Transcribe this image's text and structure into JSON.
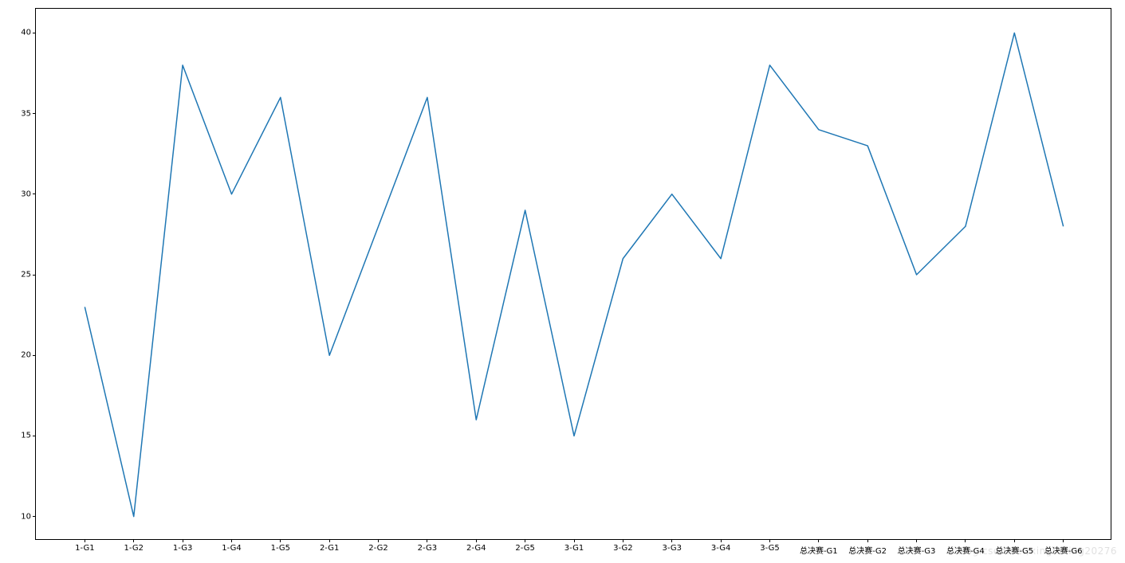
{
  "chart_data": {
    "type": "line",
    "categories": [
      "1-G1",
      "1-G2",
      "1-G3",
      "1-G4",
      "1-G5",
      "2-G1",
      "2-G2",
      "2-G3",
      "2-G4",
      "2-G5",
      "3-G1",
      "3-G2",
      "3-G3",
      "3-G4",
      "3-G5",
      "总决赛-G1",
      "总决赛-G2",
      "总决赛-G3",
      "总决赛-G4",
      "总决赛-G5",
      "总决赛-G6"
    ],
    "values": [
      23,
      10,
      38,
      30,
      36,
      20,
      28,
      36,
      16,
      29,
      15,
      26,
      30,
      26,
      38,
      34,
      33,
      25,
      28,
      40,
      28
    ],
    "title": "",
    "xlabel": "",
    "ylabel": "",
    "ylim": [
      8.5,
      41.5
    ],
    "xlim": [
      -1,
      21
    ],
    "yticks": [
      10,
      15,
      20,
      25,
      30,
      35,
      40
    ],
    "line_color": "#1f77b4"
  },
  "layout": {
    "axes_left": 44,
    "axes_top": 10,
    "axes_width": 1350,
    "axes_height": 668
  },
  "watermark": "blog.csdn.net/xingfuxing20276"
}
